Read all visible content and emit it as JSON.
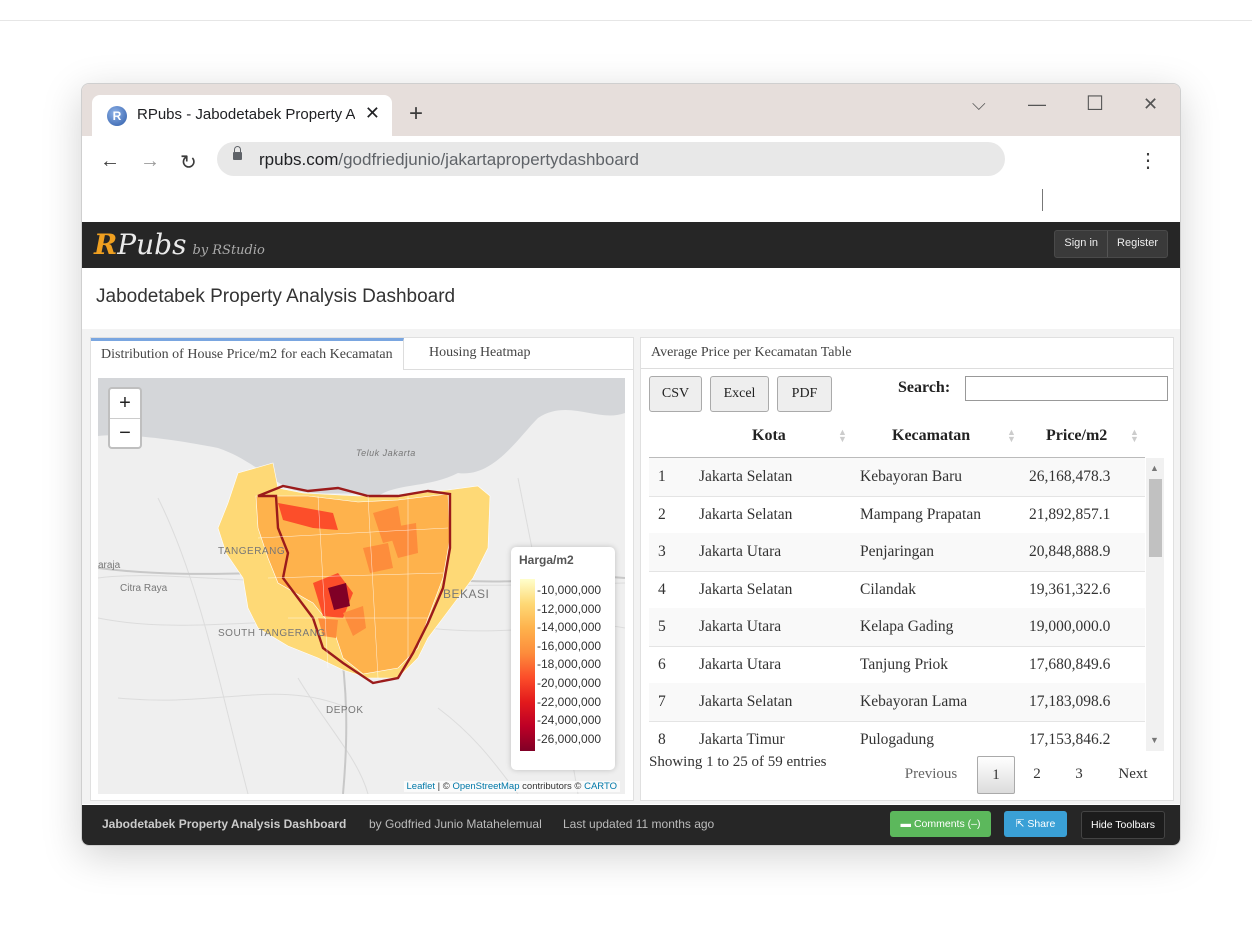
{
  "browser": {
    "tab_title": "RPubs - Jabodetabek Property Analysis Dashboard",
    "favicon_letter": "R",
    "url_domain": "rpubs.com",
    "url_path": "/godfriedjunio/jakartapropertydashboard"
  },
  "rpubs": {
    "logo_r": "R",
    "logo_rest": "Pubs",
    "logo_by": "by RStudio",
    "sign_in": "Sign in",
    "register": "Register"
  },
  "page": {
    "title": "Jabodetabek Property Analysis Dashboard"
  },
  "left_panel": {
    "tabs": [
      "Distribution of House Price/m2 for each Kecamatan",
      "Housing Heatmap"
    ],
    "zoom_in": "+",
    "zoom_out": "−",
    "map_labels": [
      "Teluk Jakarta",
      "TANGERANG",
      "Citra Raya",
      "SOUTH TANGERANG",
      "BEKASI",
      "DEPOK",
      "araja"
    ],
    "legend": {
      "title": "Harga/m2",
      "labels": [
        "10,000,000",
        "12,000,000",
        "14,000,000",
        "16,000,000",
        "18,000,000",
        "20,000,000",
        "22,000,000",
        "24,000,000",
        "26,000,000"
      ],
      "colors": [
        "#ffffcc",
        "#fed976",
        "#feb24c",
        "#fd8d3c",
        "#fc4e2a",
        "#e31a1c",
        "#bd0026",
        "#800026"
      ]
    },
    "attribution": {
      "leaflet": "Leaflet",
      "sep": " | © ",
      "osm": "OpenStreetMap",
      "contrib": " contributors © ",
      "carto": "CARTO"
    }
  },
  "right_panel": {
    "title": "Average Price per Kecamatan Table",
    "buttons": [
      "CSV",
      "Excel",
      "PDF"
    ],
    "search_label": "Search:",
    "search_value": "",
    "columns": [
      "Kota",
      "Kecamatan",
      "Price/m2"
    ],
    "rows": [
      [
        "1",
        "Jakarta Selatan",
        "Kebayoran Baru",
        "26,168,478.3"
      ],
      [
        "2",
        "Jakarta Selatan",
        "Mampang Prapatan",
        "21,892,857.1"
      ],
      [
        "3",
        "Jakarta Utara",
        "Penjaringan",
        "20,848,888.9"
      ],
      [
        "4",
        "Jakarta Selatan",
        "Cilandak",
        "19,361,322.6"
      ],
      [
        "5",
        "Jakarta Utara",
        "Kelapa Gading",
        "19,000,000.0"
      ],
      [
        "6",
        "Jakarta Utara",
        "Tanjung Priok",
        "17,680,849.6"
      ],
      [
        "7",
        "Jakarta Selatan",
        "Kebayoran Lama",
        "17,183,098.6"
      ],
      [
        "8",
        "Jakarta Timur",
        "Pulogadung",
        "17,153,846.2"
      ]
    ],
    "info": "Showing 1 to 25 of 59 entries",
    "pagination": {
      "previous": "Previous",
      "pages": [
        "1",
        "2",
        "3"
      ],
      "next": "Next"
    }
  },
  "footer": {
    "title": "Jabodetabek Property Analysis Dashboard",
    "author": "by Godfried Junio Matahelemual",
    "updated": "Last updated 11 months ago",
    "comments": "Comments (–)",
    "share": "Share",
    "hide_toolbars": "Hide Toolbars",
    "comments_color": "#5cb85c",
    "share_color": "#3aa0d6"
  }
}
